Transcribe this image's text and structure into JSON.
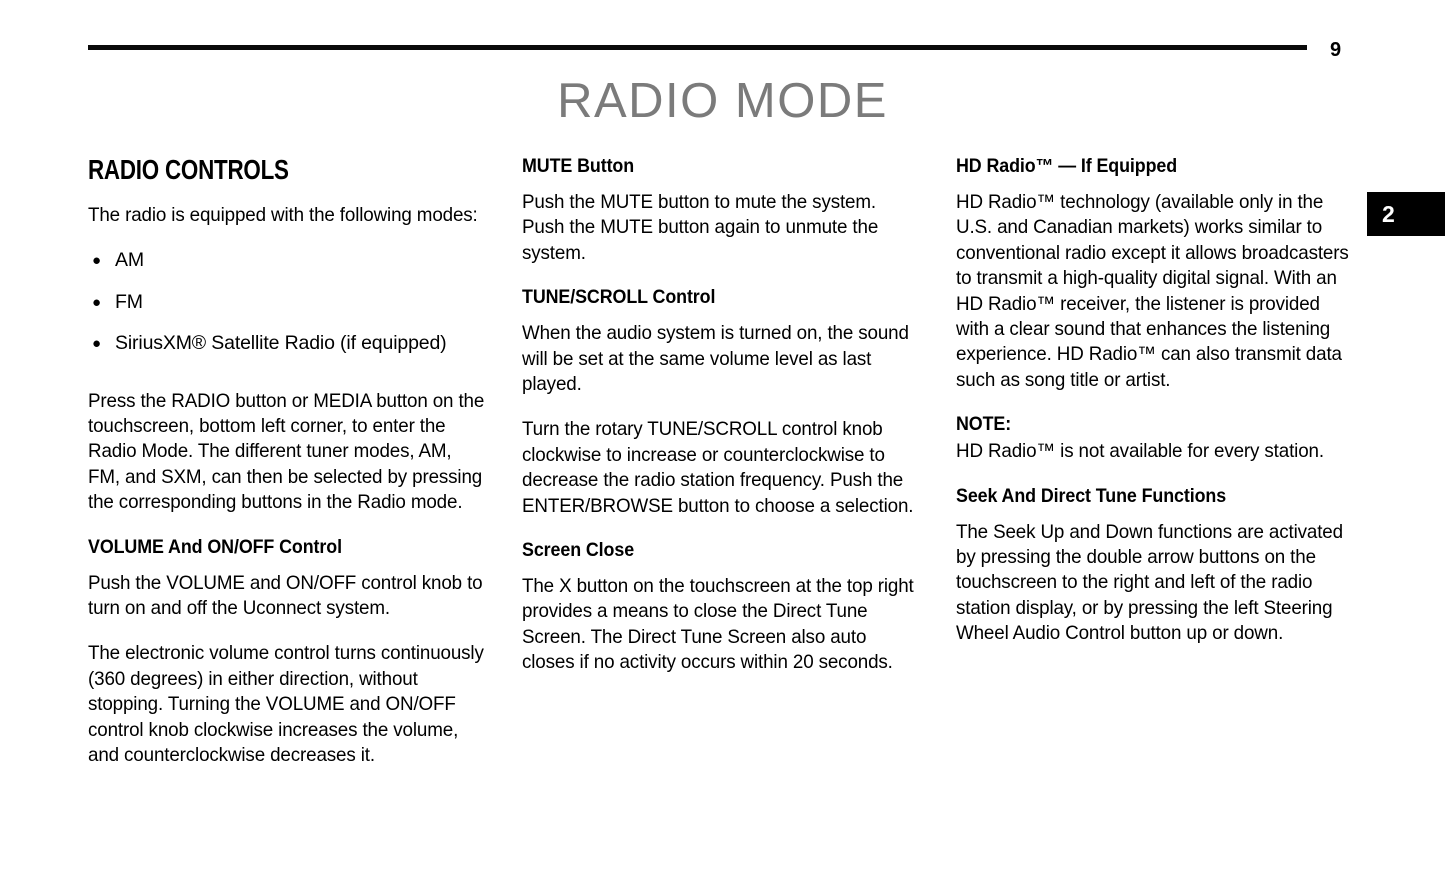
{
  "header": {
    "page_number": "9",
    "title": "RADIO MODE",
    "chapter_tab": "2"
  },
  "columns": [
    {
      "blocks": [
        {
          "type": "section-title",
          "text": "RADIO CONTROLS"
        },
        {
          "type": "body",
          "text": "The radio is equipped with the following modes:"
        },
        {
          "type": "list",
          "items": [
            "AM",
            "FM",
            "SiriusXM® Satellite Radio (if equipped)"
          ]
        },
        {
          "type": "body",
          "text": "Press the RADIO button or MEDIA button on the touchscreen, bottom left corner, to enter the Radio Mode. The different tuner modes, AM, FM, and SXM, can then be selected by pressing the corresponding buttons in the Radio mode."
        },
        {
          "type": "subhead",
          "text": "VOLUME And ON/OFF Control"
        },
        {
          "type": "body",
          "text": "Push the VOLUME and ON/OFF control knob to turn on and off the Uconnect system."
        },
        {
          "type": "body",
          "text": "The electronic volume control turns continuously (360 degrees) in either direction, without stopping. Turning the VOLUME and ON/OFF control knob clockwise increases the volume, and counterclockwise decreases it."
        }
      ]
    },
    {
      "blocks": [
        {
          "type": "subhead",
          "text": "MUTE Button"
        },
        {
          "type": "body",
          "text": "Push the MUTE button to mute the system. Push the MUTE button again to unmute the system."
        },
        {
          "type": "subhead",
          "text": "TUNE/SCROLL Control"
        },
        {
          "type": "body",
          "text": "When the audio system is turned on, the sound will be set at the same volume level as last played."
        },
        {
          "type": "body",
          "text": "Turn the rotary TUNE/SCROLL control knob clockwise to increase or counterclockwise to decrease the radio station frequency. Push the ENTER/BROWSE button to choose a selection."
        },
        {
          "type": "subhead",
          "text": "Screen Close"
        },
        {
          "type": "body",
          "text": "The X button on the touchscreen at the top right provides a means to close the Direct Tune Screen. The Direct Tune Screen also auto closes if no activity occurs within 20 seconds."
        }
      ]
    },
    {
      "blocks": [
        {
          "type": "subhead",
          "text": "HD Radio™ — If Equipped"
        },
        {
          "type": "body",
          "text": "HD Radio™ technology (available only in the U.S. and Canadian markets) works similar to conventional radio except it allows broadcasters to transmit a high-quality digital signal. With an HD Radio™ receiver, the listener is provided with a clear sound that enhances the listening experience. HD Radio™ can also transmit data such as song title or artist."
        },
        {
          "type": "subhead-tight",
          "text": "NOTE:"
        },
        {
          "type": "body",
          "text": "HD Radio™ is not available for every station."
        },
        {
          "type": "subhead",
          "text": "Seek And Direct Tune Functions"
        },
        {
          "type": "body",
          "text": "The Seek Up and Down functions are activated by pressing the double arrow buttons on the touchscreen to the right and left of the radio station display, or by pressing the left Steering Wheel Audio Control button up or down."
        }
      ]
    }
  ]
}
